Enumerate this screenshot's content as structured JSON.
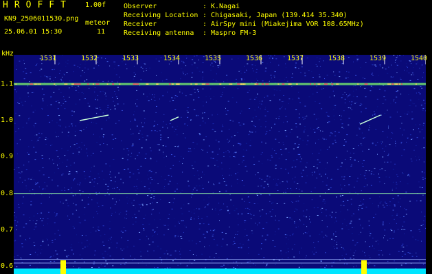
{
  "app": {
    "title": "HROFFT",
    "version": "1.00f"
  },
  "file": {
    "name": "KN9_2506011530.png",
    "datetime": "25.06.01 15:30"
  },
  "meteor": {
    "label": "meteor",
    "count": "11"
  },
  "info": [
    {
      "key": "Observer",
      "value": "K.Nagai"
    },
    {
      "key": "Receiving Location",
      "value": "Chigasaki, Japan (139.414 35.340)"
    },
    {
      "key": "Receiver",
      "value": "AirSpy mini (Miakejima VOR 108.65MHz)"
    },
    {
      "key": "Receiving antenna",
      "value": "Maspro FM-3"
    }
  ],
  "chart_data": {
    "type": "heatmap",
    "ylabel": "kHz",
    "yticks": [
      "1.1",
      "1.0",
      "0.9",
      "0.8",
      "0.7",
      "0.6"
    ],
    "xticks": [
      "1531",
      "1532",
      "1533",
      "1534",
      "1535",
      "1536",
      "1537",
      "1538",
      "1539",
      "1540"
    ],
    "ylim": [
      0.58,
      1.18
    ],
    "xlim": [
      1530,
      1540
    ],
    "carrier_khz": 1.1,
    "lines_khz": [
      0.8,
      0.62,
      0.61
    ],
    "echoes": [
      {
        "x": [
          1531.6,
          1532.3
        ],
        "y": [
          1.0,
          1.015
        ]
      },
      {
        "x": [
          1533.8,
          1534.0
        ],
        "y": [
          1.0,
          1.01
        ]
      },
      {
        "x": [
          1538.4,
          1538.9
        ],
        "y": [
          0.99,
          1.015
        ]
      }
    ],
    "colors": {
      "background": "#0a0a78",
      "noise_hi": "#7aa0ff",
      "carrier": "#9cff6a",
      "baseline": "#00e5ff",
      "spike": "#ffff00"
    }
  }
}
